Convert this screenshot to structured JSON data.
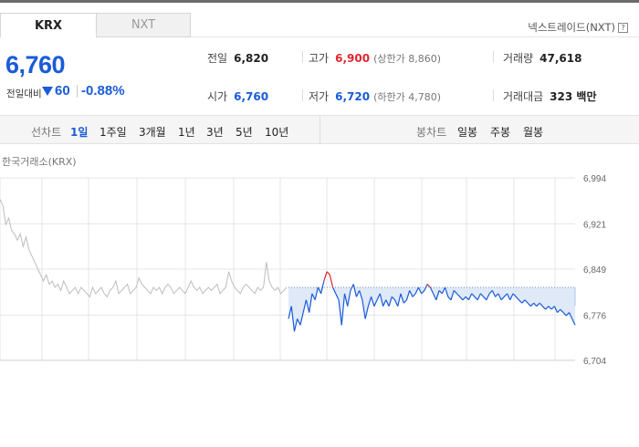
{
  "market_tabs": [
    {
      "label": "KRX",
      "active": true
    },
    {
      "label": "NXT",
      "active": false
    }
  ],
  "nxt_link": {
    "label": "넥스트레이드(NXT)",
    "help": "?"
  },
  "price": {
    "current": "6,760",
    "change_label": "전일대비",
    "change": "60",
    "change_rate": "-0.88%",
    "direction": "down"
  },
  "stats": {
    "prev_close": {
      "label": "전일",
      "value": "6,820"
    },
    "high": {
      "label": "고가",
      "value": "6,900",
      "sub": "(상한가 8,860)"
    },
    "volume": {
      "label": "거래량",
      "value": "47,618"
    },
    "open": {
      "label": "시가",
      "value": "6,760"
    },
    "low": {
      "label": "저가",
      "value": "6,720",
      "sub": "(하한가 4,780)"
    },
    "amount": {
      "label": "거래대금",
      "value": "323 백만"
    }
  },
  "line_chart_tabs": {
    "label": "선차트",
    "items": [
      "1일",
      "1주일",
      "3개월",
      "1년",
      "3년",
      "5년",
      "10년"
    ],
    "selected": "1일"
  },
  "candle_chart_tabs": {
    "label": "봉차트",
    "items": [
      "일봉",
      "주봉",
      "월봉"
    ]
  },
  "colors": {
    "up": "#e0262f",
    "down": "#1a5bd8",
    "grid": "#e4e4e4",
    "prev_day": "#bdbdbd",
    "fill": "#dfe9f8"
  },
  "chart_data": {
    "type": "line",
    "title": "한국거래소(KRX)",
    "y_ticks": [
      6994,
      6921,
      6849,
      6776,
      6704
    ],
    "ylim": [
      6704,
      6994
    ],
    "reference_price": 6820,
    "grid": true,
    "series": [
      {
        "values": [
          6960,
          6950,
          6920,
          6930,
          6910,
          6905,
          6895,
          6905,
          6885,
          6900,
          6880,
          6870,
          6860,
          6850,
          6840,
          6830,
          6840,
          6825,
          6830,
          6820,
          6825,
          6815,
          6830,
          6820,
          6810,
          6815,
          6820,
          6810,
          6820,
          6815,
          6810,
          6805,
          6820,
          6810,
          6815,
          6820,
          6810,
          6805,
          6815,
          6820,
          6830,
          6810,
          6815,
          6820,
          6825,
          6810,
          6815,
          6820,
          6835,
          6825,
          6820,
          6815,
          6810,
          6820,
          6815,
          6820,
          6810,
          6820,
          6825,
          6820,
          6810,
          6815,
          6820,
          6815,
          6810,
          6820,
          6830,
          6820,
          6815,
          6820,
          6810,
          6815,
          6820,
          6815,
          6820,
          6825,
          6810,
          6815,
          6820,
          6845,
          6830,
          6820,
          6815,
          6810,
          6820,
          6825,
          6820,
          6815,
          6810,
          6820,
          6815,
          6820,
          6860,
          6830,
          6820,
          6815,
          6820,
          6810,
          6815,
          6820
        ]
      },
      {
        "values": [
          6770,
          6790,
          6750,
          6770,
          6760,
          6780,
          6800,
          6780,
          6810,
          6800,
          6820,
          6810,
          6830,
          6845,
          6840,
          6820,
          6810,
          6800,
          6760,
          6810,
          6790,
          6815,
          6825,
          6805,
          6815,
          6800,
          6770,
          6790,
          6805,
          6790,
          6800,
          6810,
          6790,
          6800,
          6790,
          6805,
          6800,
          6790,
          6810,
          6795,
          6800,
          6815,
          6805,
          6810,
          6820,
          6810,
          6815,
          6825,
          6820,
          6810,
          6800,
          6815,
          6810,
          6820,
          6805,
          6800,
          6815,
          6810,
          6805,
          6800,
          6805,
          6800,
          6810,
          6805,
          6800,
          6810,
          6805,
          6800,
          6810,
          6815,
          6805,
          6810,
          6800,
          6805,
          6810,
          6800,
          6810,
          6805,
          6800,
          6795,
          6800,
          6795,
          6790,
          6795,
          6790,
          6795,
          6790,
          6785,
          6790,
          6785,
          6790,
          6780,
          6785,
          6780,
          6775,
          6780,
          6770,
          6760
        ]
      }
    ]
  }
}
